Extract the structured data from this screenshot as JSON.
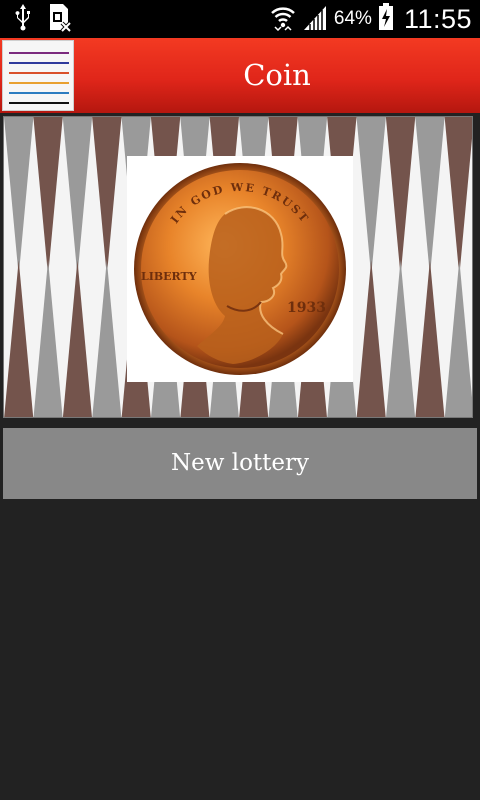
{
  "status_bar": {
    "battery_percent": "64%",
    "time": "11:55",
    "icons": [
      "usb-icon",
      "sim-card-icon",
      "wifi-icon",
      "signal-icon",
      "battery-charging-icon"
    ]
  },
  "title_bar": {
    "title": "Coin",
    "menu_icon": "menu-lines-icon",
    "menu_line_colors": [
      "#7b2a7e",
      "#2f3a9c",
      "#d9502a",
      "#e8a030",
      "#2c7cc0",
      "#111111"
    ]
  },
  "board": {
    "colors": {
      "light": "#f4f4f4",
      "gray": "#9a9a9a",
      "brown": "#74544c"
    },
    "coin": {
      "top_inscription": "IN GOD WE TRUST",
      "left_inscription": "LIBERTY",
      "year": "1933"
    }
  },
  "actions": {
    "new_lottery_label": "New lottery"
  }
}
